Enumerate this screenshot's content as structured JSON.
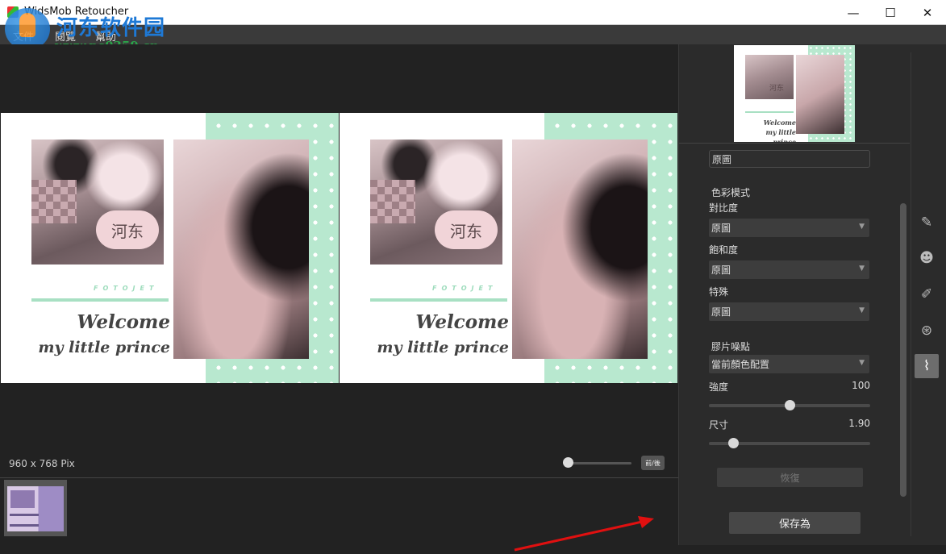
{
  "window": {
    "title": "WidsMob Retoucher",
    "minimize": "—",
    "maximize": "☐",
    "close": "✕"
  },
  "watermark": {
    "cn": "河东软件园",
    "url": "www.pc0359.cn"
  },
  "menu": {
    "items": [
      "文件",
      "閱覽",
      "幫助"
    ]
  },
  "canvas": {
    "overlay_text": "河东",
    "fotojet": "FOTOJET",
    "welcome": "Welcome",
    "subtitle": "my little prince",
    "dimensions": "960 x 768 Pix",
    "before_after": "前/後",
    "zoom_level": 0.0
  },
  "panel": {
    "top_field": "原圖",
    "color_mode_label": "色彩模式",
    "contrast_label": "對比度",
    "contrast_value": "原圖",
    "saturation_label": "飽和度",
    "saturation_value": "原圖",
    "special_label": "特殊",
    "special_value": "原圖",
    "grain_label": "膠片噪點",
    "grain_value": "當前顏色配置",
    "strength_label": "強度",
    "strength_value": "100",
    "strength_level": 0.5,
    "size_label": "尺寸",
    "size_value": "1.90",
    "size_level": 0.15,
    "restore_label": "恢復",
    "save_label": "保存為"
  },
  "tools": [
    {
      "name": "pencil-icon",
      "glyph": "✎",
      "active": false
    },
    {
      "name": "face-icon",
      "glyph": "☻",
      "active": false
    },
    {
      "name": "brush-icon",
      "glyph": "✐",
      "active": false
    },
    {
      "name": "color-circles-icon",
      "glyph": "⊛",
      "active": false
    },
    {
      "name": "film-icon",
      "glyph": "⌇",
      "active": true
    }
  ],
  "colors": {
    "mint": "#b8e8cf",
    "background": "#222222",
    "annotation_arrow": "#e01010"
  }
}
